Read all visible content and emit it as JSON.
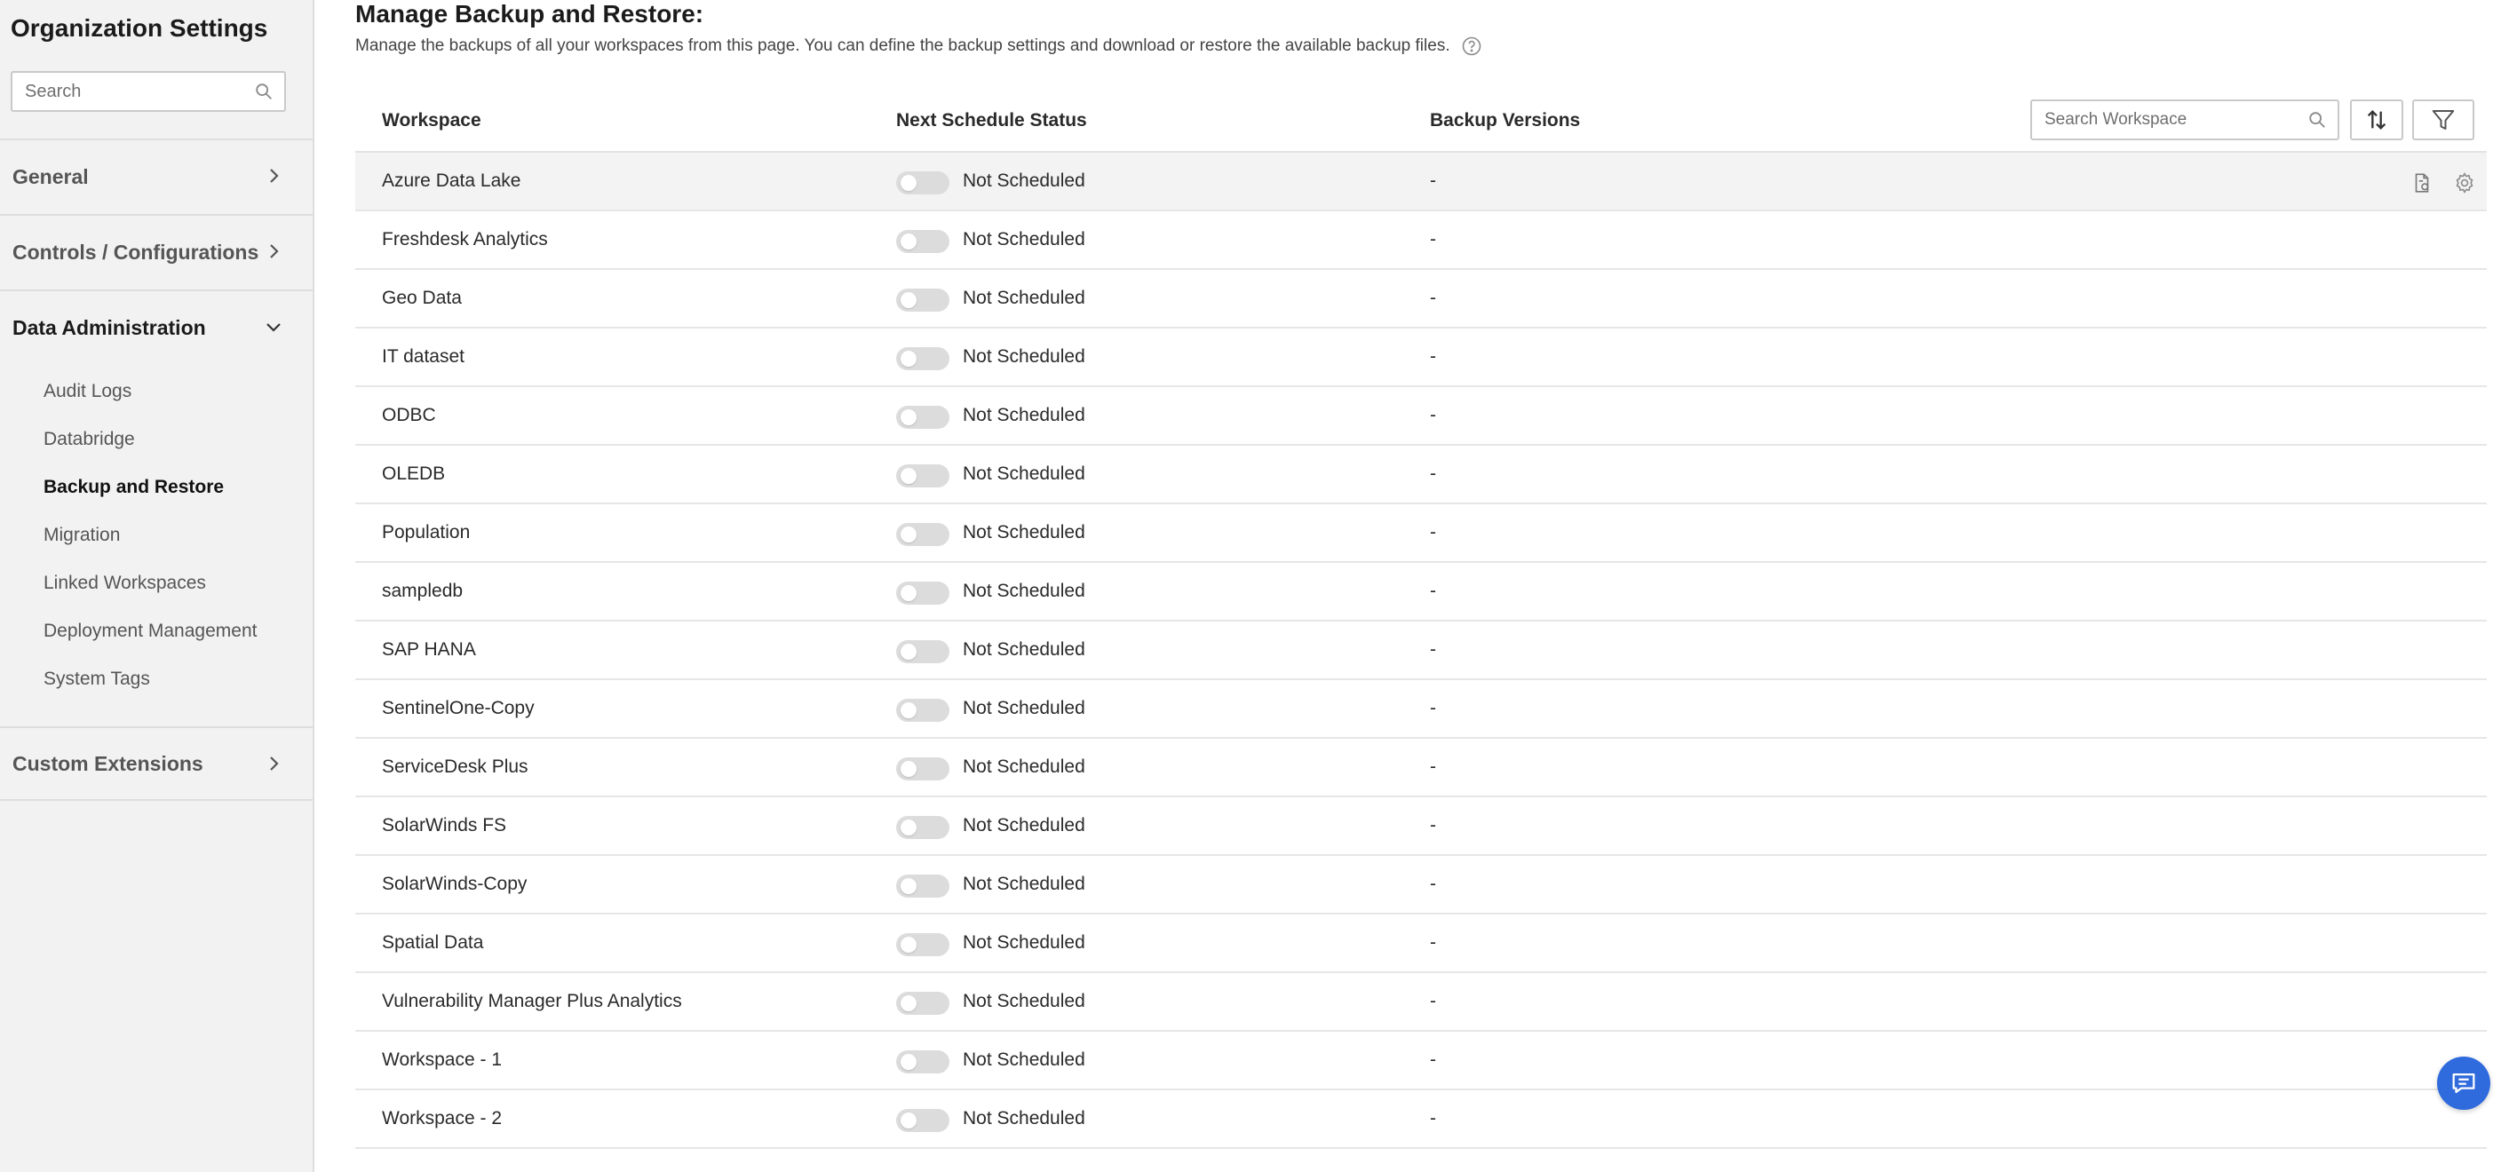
{
  "sidebar": {
    "title": "Organization Settings",
    "search_placeholder": "Search",
    "sections": [
      {
        "label": "General",
        "expanded": false
      },
      {
        "label": "Controls / Configurations",
        "expanded": false
      },
      {
        "label": "Data Administration",
        "expanded": true
      },
      {
        "label": "Custom Extensions",
        "expanded": false
      }
    ],
    "data_admin_items": [
      {
        "label": "Audit Logs"
      },
      {
        "label": "Databridge"
      },
      {
        "label": "Backup and Restore",
        "selected": true
      },
      {
        "label": "Migration"
      },
      {
        "label": "Linked Workspaces"
      },
      {
        "label": "Deployment Management"
      },
      {
        "label": "System Tags"
      }
    ]
  },
  "main": {
    "title": "Manage Backup and Restore:",
    "description": "Manage the backups of all your workspaces from this page. You can define the backup settings and download or restore the available backup files.",
    "columns": {
      "workspace": "Workspace",
      "status": "Next Schedule Status",
      "versions": "Backup Versions"
    },
    "search_placeholder": "Search Workspace",
    "rows": [
      {
        "workspace": "Azure Data Lake",
        "status": "Not Scheduled",
        "versions": "-",
        "scheduled": false
      },
      {
        "workspace": "Freshdesk Analytics",
        "status": "Not Scheduled",
        "versions": "-",
        "scheduled": false
      },
      {
        "workspace": "Geo Data",
        "status": "Not Scheduled",
        "versions": "-",
        "scheduled": false
      },
      {
        "workspace": "IT dataset",
        "status": "Not Scheduled",
        "versions": "-",
        "scheduled": false
      },
      {
        "workspace": "ODBC",
        "status": "Not Scheduled",
        "versions": "-",
        "scheduled": false
      },
      {
        "workspace": "OLEDB",
        "status": "Not Scheduled",
        "versions": "-",
        "scheduled": false
      },
      {
        "workspace": "Population",
        "status": "Not Scheduled",
        "versions": "-",
        "scheduled": false
      },
      {
        "workspace": "sampledb",
        "status": "Not Scheduled",
        "versions": "-",
        "scheduled": false
      },
      {
        "workspace": "SAP HANA",
        "status": "Not Scheduled",
        "versions": "-",
        "scheduled": false
      },
      {
        "workspace": "SentinelOne-Copy",
        "status": "Not Scheduled",
        "versions": "-",
        "scheduled": false
      },
      {
        "workspace": "ServiceDesk Plus",
        "status": "Not Scheduled",
        "versions": "-",
        "scheduled": false
      },
      {
        "workspace": "SolarWinds FS",
        "status": "Not Scheduled",
        "versions": "-",
        "scheduled": false
      },
      {
        "workspace": "SolarWinds-Copy",
        "status": "Not Scheduled",
        "versions": "-",
        "scheduled": false
      },
      {
        "workspace": "Spatial Data",
        "status": "Not Scheduled",
        "versions": "-",
        "scheduled": false
      },
      {
        "workspace": "Vulnerability Manager Plus Analytics",
        "status": "Not Scheduled",
        "versions": "-",
        "scheduled": false
      },
      {
        "workspace": "Workspace - 1",
        "status": "Not Scheduled",
        "versions": "-",
        "scheduled": false
      },
      {
        "workspace": "Workspace - 2",
        "status": "Not Scheduled",
        "versions": "-",
        "scheduled": false
      }
    ]
  },
  "icons": {
    "search": "search-icon",
    "chevron_right": "chevron-right-icon",
    "chevron_down": "chevron-down-icon",
    "help": "help-circle-icon",
    "sort": "sort-icon",
    "filter": "filter-icon",
    "backup_file": "backup-file-icon",
    "settings": "gear-icon",
    "chat": "chat-icon"
  },
  "colors": {
    "sidebar_bg": "#f2f2f2",
    "row_hover": "#f3f3f4",
    "toggle_off": "#dcdcdc",
    "chat_fab": "#2f6bdc"
  }
}
